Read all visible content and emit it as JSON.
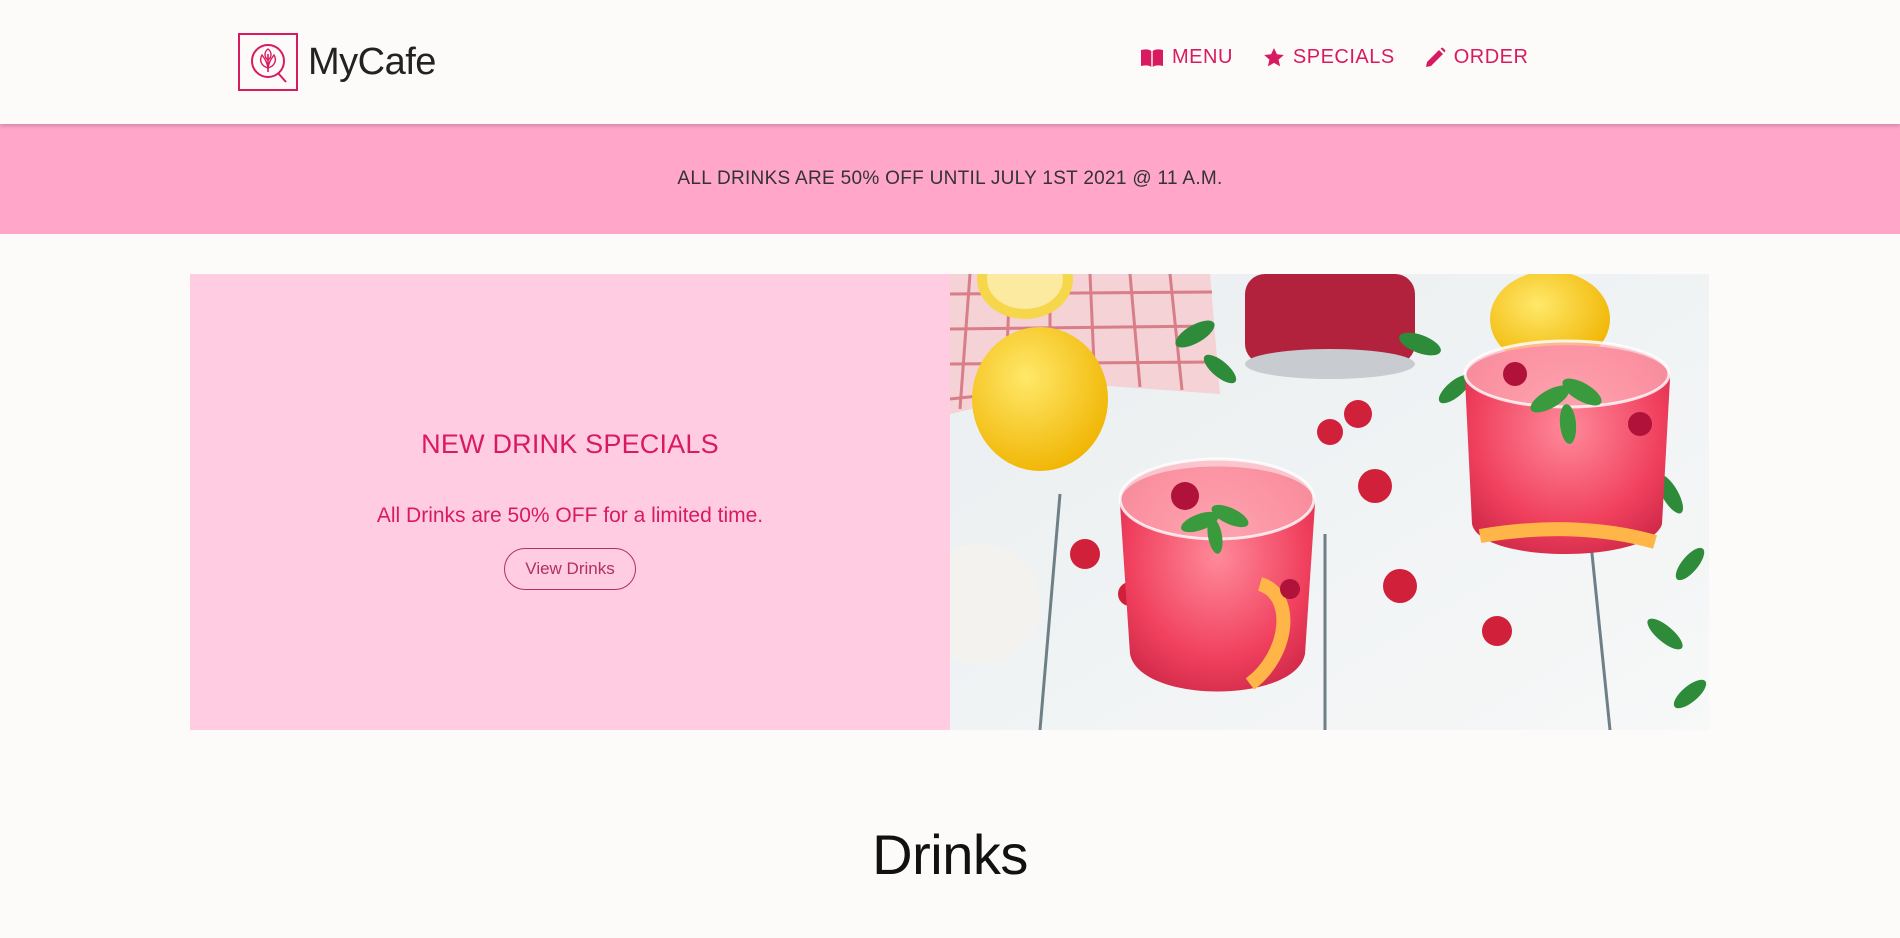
{
  "brand": {
    "name": "MyCafe",
    "accent_color": "#d81b60",
    "logo_icon": "coffee-leaf-icon"
  },
  "nav": {
    "items": [
      {
        "label": "MENU",
        "icon": "book-open-icon"
      },
      {
        "label": "SPECIALS",
        "icon": "star-icon"
      },
      {
        "label": "ORDER",
        "icon": "pencil-icon"
      }
    ]
  },
  "announcement": {
    "text": "ALL DRINKS ARE 50% OFF UNTIL JULY 1ST 2021 @ 11 A.M.",
    "background": "#ffa6c9"
  },
  "hero": {
    "title": "NEW DRINK SPECIALS",
    "subtitle": "All Drinks are 50% OFF for a limited time.",
    "button_label": "View Drinks",
    "panel_color": "#ffcce2"
  },
  "drinks_section": {
    "title": "Drinks"
  }
}
